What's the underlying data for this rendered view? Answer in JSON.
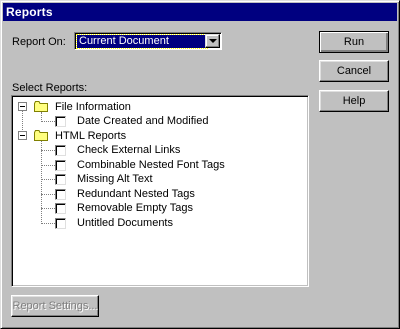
{
  "window": {
    "title": "Reports"
  },
  "report_on": {
    "label": "Report On:",
    "value": "Current Document"
  },
  "select_reports": {
    "label": "Select Reports:",
    "groups": [
      {
        "label": "File Information",
        "items": [
          "Date Created and Modified"
        ]
      },
      {
        "label": "HTML Reports",
        "items": [
          "Check External Links",
          "Combinable Nested Font Tags",
          "Missing Alt Text",
          "Redundant Nested Tags",
          "Removable Empty Tags",
          "Untitled Documents"
        ]
      }
    ]
  },
  "buttons": {
    "run": "Run",
    "cancel": "Cancel",
    "help": "Help",
    "report_settings": "Report Settings..."
  },
  "colors": {
    "title_bar": "#000080",
    "face": "#c0c0c0",
    "folder": "#ffff80"
  },
  "icons": {
    "folder": "folder-icon",
    "collapse": "collapse-icon",
    "dropdown": "chevron-down-icon"
  }
}
